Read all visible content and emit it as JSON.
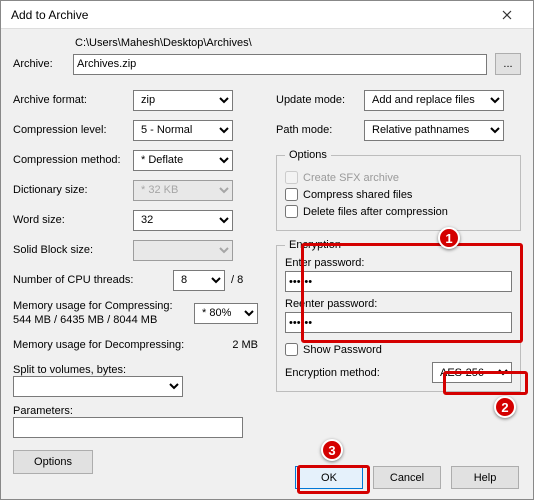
{
  "window": {
    "title": "Add to Archive"
  },
  "archive": {
    "label": "Archive:",
    "path_display": "C:\\Users\\Mahesh\\Desktop\\Archives\\",
    "filename": "Archives.zip",
    "browse_label": "..."
  },
  "left": {
    "archive_format": {
      "label": "Archive format:",
      "value": "zip"
    },
    "compression_level": {
      "label": "Compression level:",
      "value": "5 - Normal"
    },
    "compression_method": {
      "label": "Compression method:",
      "value": "* Deflate"
    },
    "dictionary_size": {
      "label": "Dictionary size:",
      "value": "* 32 KB"
    },
    "word_size": {
      "label": "Word size:",
      "value": "32"
    },
    "solid_block_size": {
      "label": "Solid Block size:",
      "value": ""
    },
    "cpu_threads": {
      "label": "Number of CPU threads:",
      "value": "8",
      "suffix": "/ 8"
    },
    "mem_compress": {
      "label1": "Memory usage for Compressing:",
      "label2": "544 MB / 6435 MB / 8044 MB",
      "value": "* 80%"
    },
    "mem_decompress": {
      "label": "Memory usage for Decompressing:",
      "value": "2 MB"
    },
    "split": {
      "label": "Split to volumes, bytes:",
      "value": ""
    },
    "parameters": {
      "label": "Parameters:",
      "value": ""
    },
    "options_btn": "Options"
  },
  "right": {
    "update_mode": {
      "label": "Update mode:",
      "value": "Add and replace files"
    },
    "path_mode": {
      "label": "Path mode:",
      "value": "Relative pathnames"
    },
    "options": {
      "legend": "Options",
      "sfx": "Create SFX archive",
      "compress_shared": "Compress shared files",
      "delete_after": "Delete files after compression"
    },
    "encryption": {
      "legend": "Encryption",
      "enter_label": "Enter password:",
      "enter_value": "••••••",
      "reenter_label": "Reenter password:",
      "reenter_value": "••••••",
      "show_password": "Show Password",
      "method_label": "Encryption method:",
      "method_value": "AES-256"
    }
  },
  "buttons": {
    "ok": "OK",
    "cancel": "Cancel",
    "help": "Help"
  },
  "callouts": {
    "c1": "1",
    "c2": "2",
    "c3": "3"
  }
}
